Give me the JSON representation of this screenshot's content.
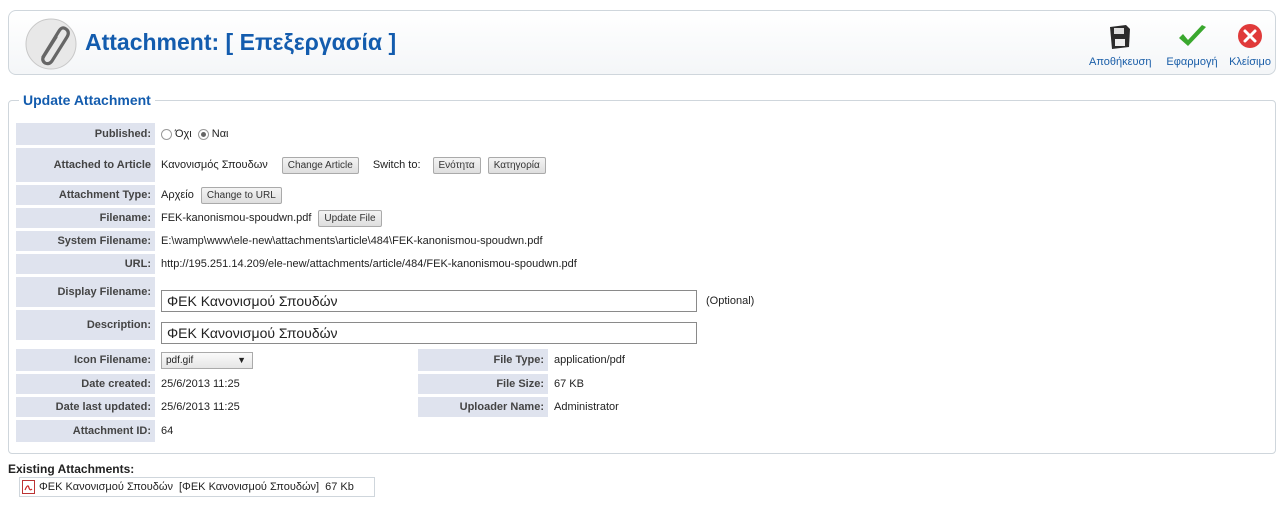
{
  "header": {
    "title": "Attachment: [ Επεξεργασία ]",
    "save_label": "Αποθήκευση",
    "apply_label": "Εφαρμογή",
    "close_label": "Κλείσιμο"
  },
  "form": {
    "legend": "Update Attachment",
    "published": {
      "label": "Published:",
      "opt_no": "Όχι",
      "opt_yes": "Ναι",
      "selected": "Ναι"
    },
    "attached_to": {
      "label": "Attached to Article",
      "value": "Κανονισμός Σπουδων",
      "change_btn": "Change Article",
      "switch_label": "Switch to:",
      "switch_btn1": "Ενότητα",
      "switch_btn2": "Κατηγορία"
    },
    "attachment_type": {
      "label": "Attachment Type:",
      "value": "Αρχείο",
      "change_btn": "Change to URL"
    },
    "filename": {
      "label": "Filename:",
      "value": "FEK-kanonismou-spoudwn.pdf",
      "update_btn": "Update File"
    },
    "system_filename": {
      "label": "System Filename:",
      "value": "E:\\wamp\\www\\ele-new\\attachments\\article\\484\\FEK-kanonismou-spoudwn.pdf"
    },
    "url": {
      "label": "URL:",
      "value": "http://195.251.14.209/ele-new/attachments/article/484/FEK-kanonismou-spoudwn.pdf"
    },
    "display_filename": {
      "label": "Display Filename:",
      "value": "ΦΕΚ Κανονισμού Σπουδών",
      "hint": "(Optional)"
    },
    "description": {
      "label": "Description:",
      "value": "ΦΕΚ Κανονισμού Σπουδών"
    },
    "icon_filename": {
      "label": "Icon Filename:",
      "value": "pdf.gif"
    },
    "date_created": {
      "label": "Date created:",
      "value": "25/6/2013 11:25"
    },
    "date_updated": {
      "label": "Date last updated:",
      "value": "25/6/2013 11:25"
    },
    "attachment_id": {
      "label": "Attachment ID:",
      "value": "64"
    },
    "file_type": {
      "label": "File Type:",
      "value": "application/pdf"
    },
    "file_size": {
      "label": "File Size:",
      "value": "67 KB"
    },
    "uploader": {
      "label": "Uploader Name:",
      "value": "Administrator"
    }
  },
  "existing": {
    "title": "Existing Attachments:",
    "item_name": "ΦΕΚ Κανονισμού Σπουδών",
    "item_desc": "[ΦΕΚ Κανονισμού Σπουδών]",
    "item_size": "67 Kb"
  },
  "colors": {
    "title_blue": "#135cae",
    "label_bg": "#dfe3ee",
    "apply_green": "#3aa82e",
    "close_red": "#e03a3a"
  }
}
